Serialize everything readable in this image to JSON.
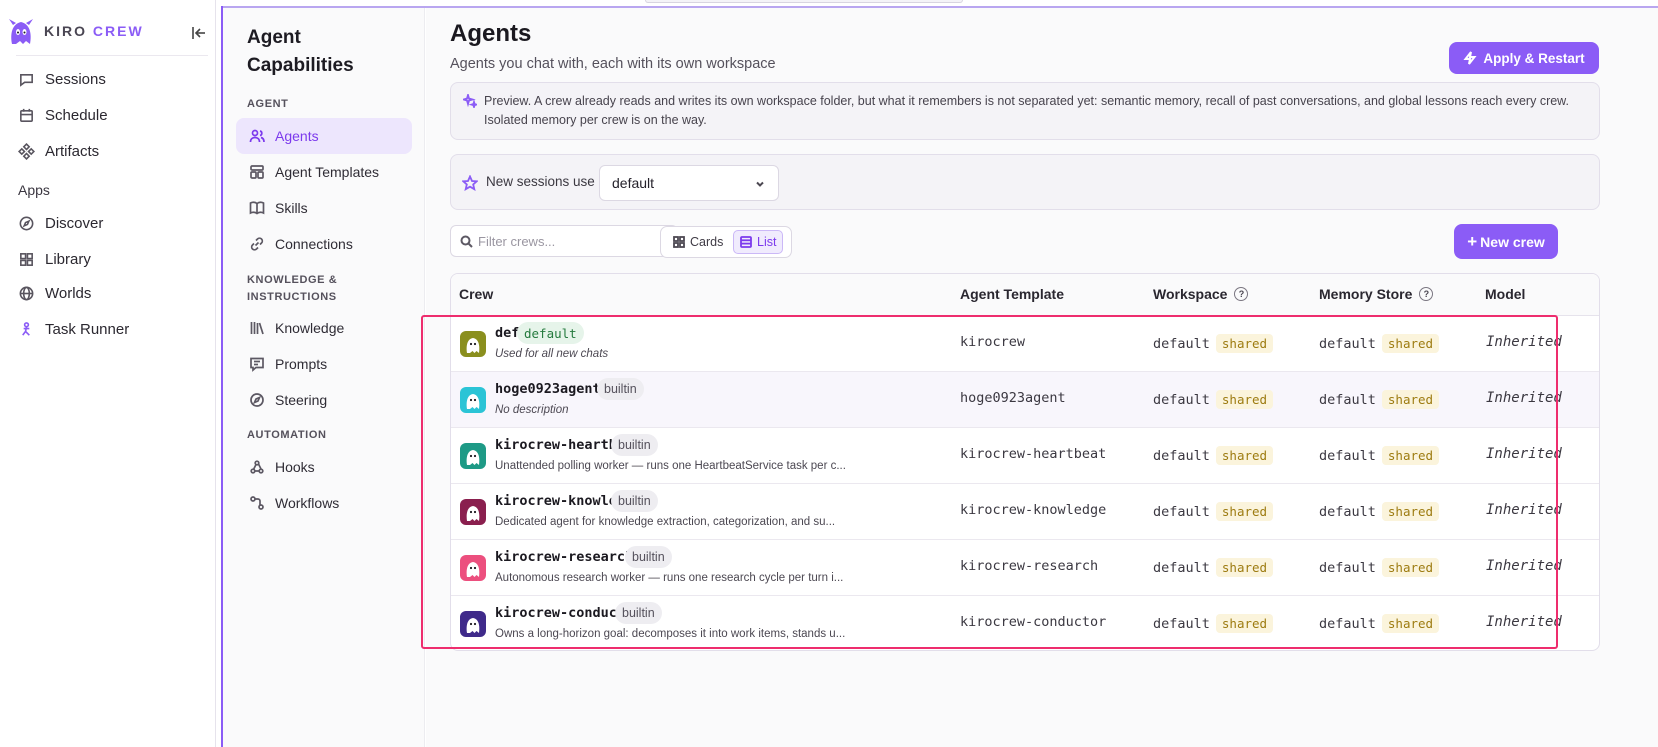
{
  "brand": {
    "kiro": "KIRO",
    "crew": "CREW"
  },
  "sidebar": {
    "items": [
      {
        "label": "Sessions",
        "icon": "chat-icon"
      },
      {
        "label": "Schedule",
        "icon": "calendar-icon"
      },
      {
        "label": "Artifacts",
        "icon": "artifacts-icon"
      }
    ],
    "apps_label": "Apps",
    "apps": [
      {
        "label": "Discover",
        "icon": "compass-icon"
      },
      {
        "label": "Library",
        "icon": "grid-icon"
      },
      {
        "label": "Worlds",
        "icon": "globe-icon"
      },
      {
        "label": "Task Runner",
        "icon": "runner-icon"
      }
    ]
  },
  "capabilities": {
    "title": "Agent Capabilities",
    "sections": {
      "agent": "AGENT",
      "knowledge": "KNOWLEDGE & INSTRUCTIONS",
      "automation": "AUTOMATION"
    },
    "items": {
      "agents": "Agents",
      "agent_templates": "Agent Templates",
      "skills": "Skills",
      "connections": "Connections",
      "knowledge": "Knowledge",
      "prompts": "Prompts",
      "steering": "Steering",
      "hooks": "Hooks",
      "workflows": "Workflows"
    }
  },
  "main": {
    "title": "Agents",
    "subtitle": "Agents you chat with, each with its own workspace",
    "apply_label": "Apply & Restart",
    "preview_text": "Preview. A crew already reads and writes its own workspace folder, but what it remembers is not separated yet: semantic memory, recall of past conversations, and global lessons reach every crew. Isolated memory per crew is on the way.",
    "new_sessions_label": "New sessions use",
    "new_sessions_value": "default",
    "filter_placeholder": "Filter crews...",
    "view_cards": "Cards",
    "view_list": "List",
    "new_crew_label": "New crew"
  },
  "table": {
    "headers": {
      "crew": "Crew",
      "template": "Agent Template",
      "workspace": "Workspace",
      "memory": "Memory Store",
      "model": "Model",
      "help": "?"
    },
    "rows": [
      {
        "name": "default",
        "badge": "default",
        "desc": "Used for all new chats",
        "template": "kirocrew",
        "workspace": "default",
        "workspace_tag": "shared",
        "memory": "default",
        "memory_tag": "shared",
        "model": "Inherited",
        "color": "#8a8f1e"
      },
      {
        "name": "hoge0923agent",
        "badge": "builtin",
        "desc": "No description",
        "template": "hoge0923agent",
        "workspace": "default",
        "workspace_tag": "shared",
        "memory": "default",
        "memory_tag": "shared",
        "model": "Inherited",
        "color": "#2bc4d6"
      },
      {
        "name": "kirocrew-heartbeat",
        "badge": "builtin",
        "desc": "Unattended polling worker — runs one HeartbeatService task per c...",
        "template": "kirocrew-heartbeat",
        "workspace": "default",
        "workspace_tag": "shared",
        "memory": "default",
        "memory_tag": "shared",
        "model": "Inherited",
        "color": "#1e9a86"
      },
      {
        "name": "kirocrew-knowledge",
        "badge": "builtin",
        "desc": "Dedicated agent for knowledge extraction, categorization, and su...",
        "template": "kirocrew-knowledge",
        "workspace": "default",
        "workspace_tag": "shared",
        "memory": "default",
        "memory_tag": "shared",
        "model": "Inherited",
        "color": "#8a1f4e"
      },
      {
        "name": "kirocrew-research",
        "badge": "builtin",
        "desc": "Autonomous research worker — runs one research cycle per turn i...",
        "template": "kirocrew-research",
        "workspace": "default",
        "workspace_tag": "shared",
        "memory": "default",
        "memory_tag": "shared",
        "model": "Inherited",
        "color": "#ec4f7e"
      },
      {
        "name": "kirocrew-conductor",
        "badge": "builtin",
        "desc": "Owns a long-horizon goal: decomposes it into work items, stands u...",
        "template": "kirocrew-conductor",
        "workspace": "default",
        "workspace_tag": "shared",
        "memory": "default",
        "memory_tag": "shared",
        "model": "Inherited",
        "color": "#3f2a8a"
      }
    ]
  }
}
